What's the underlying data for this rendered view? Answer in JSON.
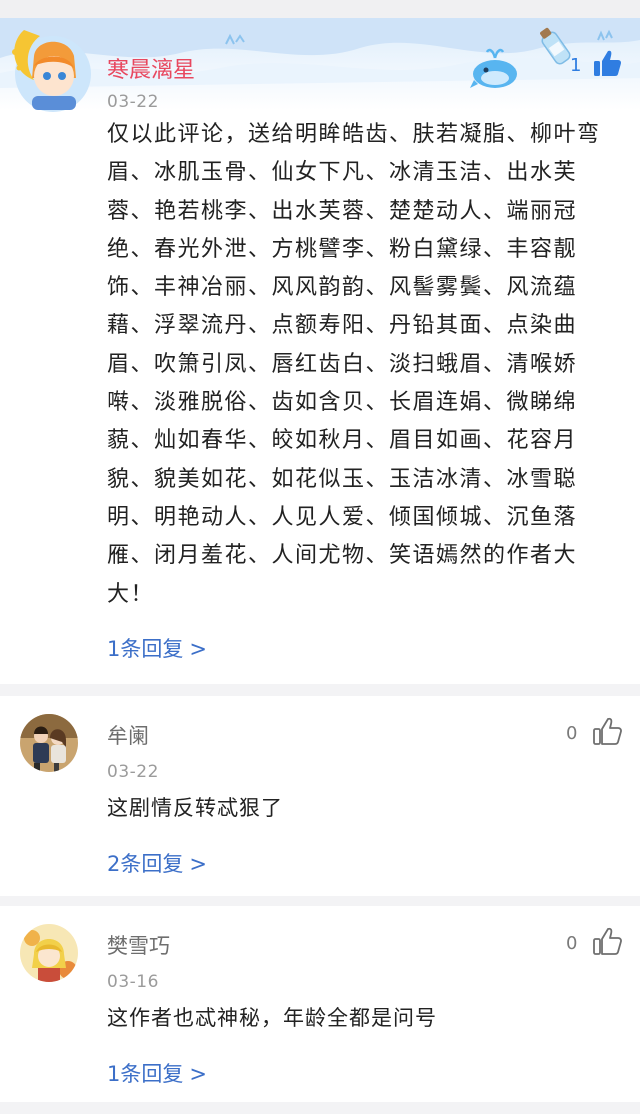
{
  "comments": [
    {
      "name": "寒晨漓星",
      "date": "03-22",
      "likes": "1",
      "text": "仅以此评论，送给明眸皓齿、肤若凝脂、柳叶弯眉、冰肌玉骨、仙女下凡、冰清玉洁、出水芙蓉、艳若桃李、出水芙蓉、楚楚动人、端丽冠绝、春光外泄、方桃譬李、粉白黛绿、丰容靓饰、丰神冶丽、风风韵韵、风髻雾鬓、风流蕴藉、浮翠流丹、点额寿阳、丹铅其面、点染曲眉、吹箫引凤、唇红齿白、淡扫蛾眉、清喉娇啭、淡雅脱俗、齿如含贝、长眉连娟、微睇绵藐、灿如春华、皎如秋月、眉目如画、花容月貌、貌美如花、如花似玉、玉洁冰清、冰雪聪明、明艳动人、人见人爱、倾国倾城、沉鱼落雁、闭月羞花、人间尤物、笑语嫣然的作者大大！",
      "reply": "1条回复",
      "liked": true,
      "avatar_icon": "anime-boy-moon-avatar"
    },
    {
      "name": "牟阑",
      "date": "03-22",
      "likes": "0",
      "text": "这剧情反转忒狠了",
      "reply": "2条回复",
      "liked": false,
      "avatar_icon": "couple-photo-avatar"
    },
    {
      "name": "樊雪巧",
      "date": "03-16",
      "likes": "0",
      "text": "这作者也忒神秘，年龄全都是问号",
      "reply": "1条回复",
      "liked": false,
      "avatar_icon": "anime-yellow-avatar"
    }
  ],
  "chevron": ">",
  "colors": {
    "name_highlight": "#e8485f",
    "link_blue": "#3c6fc8",
    "like_blue": "#2f7de1"
  }
}
